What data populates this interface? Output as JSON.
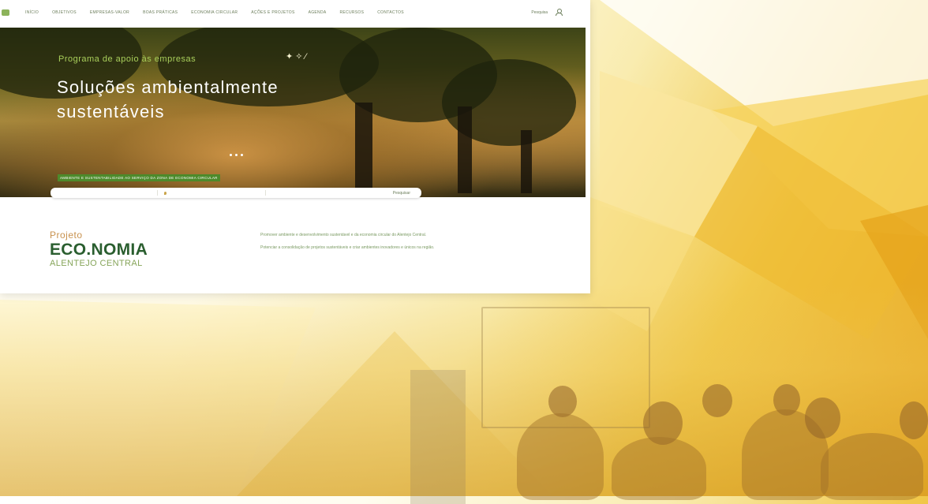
{
  "nav": {
    "items": [
      "Início",
      "Objetivos",
      "Empresas-Valor",
      "Boas práticas",
      "Economia circular",
      "Ações e projetos",
      "Agenda",
      "Recursos",
      "Contactos"
    ],
    "right_label": "Pesquisa",
    "user_icon": "user-icon"
  },
  "hero": {
    "subtitle": "Programa de apoio às empresas",
    "title": "Soluções ambientalmente sustentáveis",
    "banner": "Ambiente e sustentabilidade ao serviço da zona de economia circular"
  },
  "search": {
    "field1": "",
    "field2": "",
    "field3": "",
    "button": "Pesquisar"
  },
  "brand": {
    "pre": "Projeto",
    "main": "ECO.NOMIA",
    "sub": "ALENTEJO CENTRAL"
  },
  "intro": {
    "p1": "Promover ambiente e desenvolvimento sustentável e da economia circular do Alentejo Central.",
    "p2": "Potenciar a consolidação de projetos sustentáveis e criar ambientes inovadores e únicos na região."
  },
  "colors": {
    "accent": "#4d8a2b",
    "brand_green": "#2a5e2f",
    "brand_orange": "#c8924e",
    "background_yellow": "#f1c94b"
  }
}
